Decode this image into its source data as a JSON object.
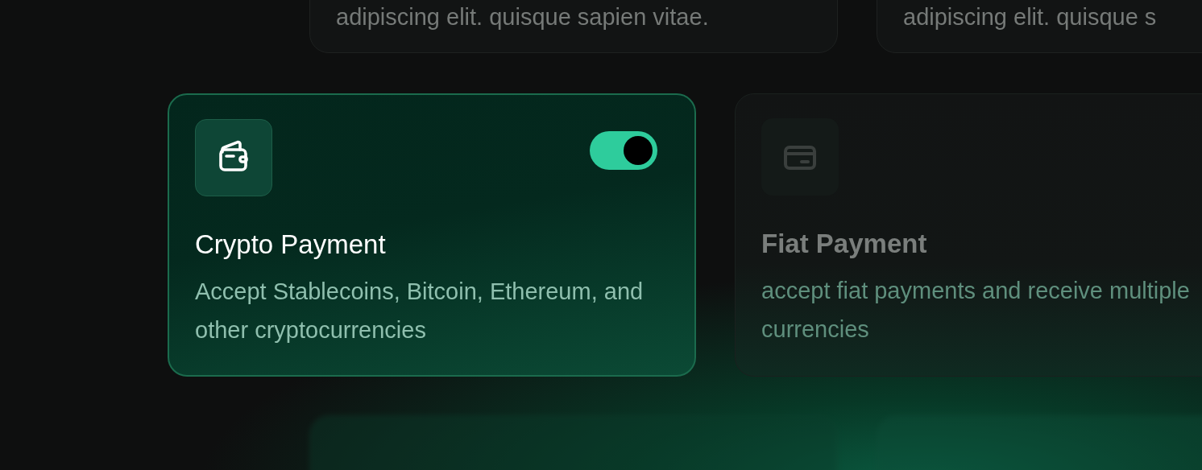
{
  "top_cards": [
    {
      "description": "adipiscing elit. quisque sapien vitae."
    },
    {
      "description": "adipiscing elit. quisque s"
    }
  ],
  "payment_cards": [
    {
      "title": "Crypto Payment",
      "description": "Accept Stablecoins, Bitcoin, Ethereum, and other cryptocurrencies",
      "on": true,
      "selected": true
    },
    {
      "title": "Fiat Payment",
      "description": "accept fiat payments and receive multiple currencies",
      "selected": false
    }
  ]
}
